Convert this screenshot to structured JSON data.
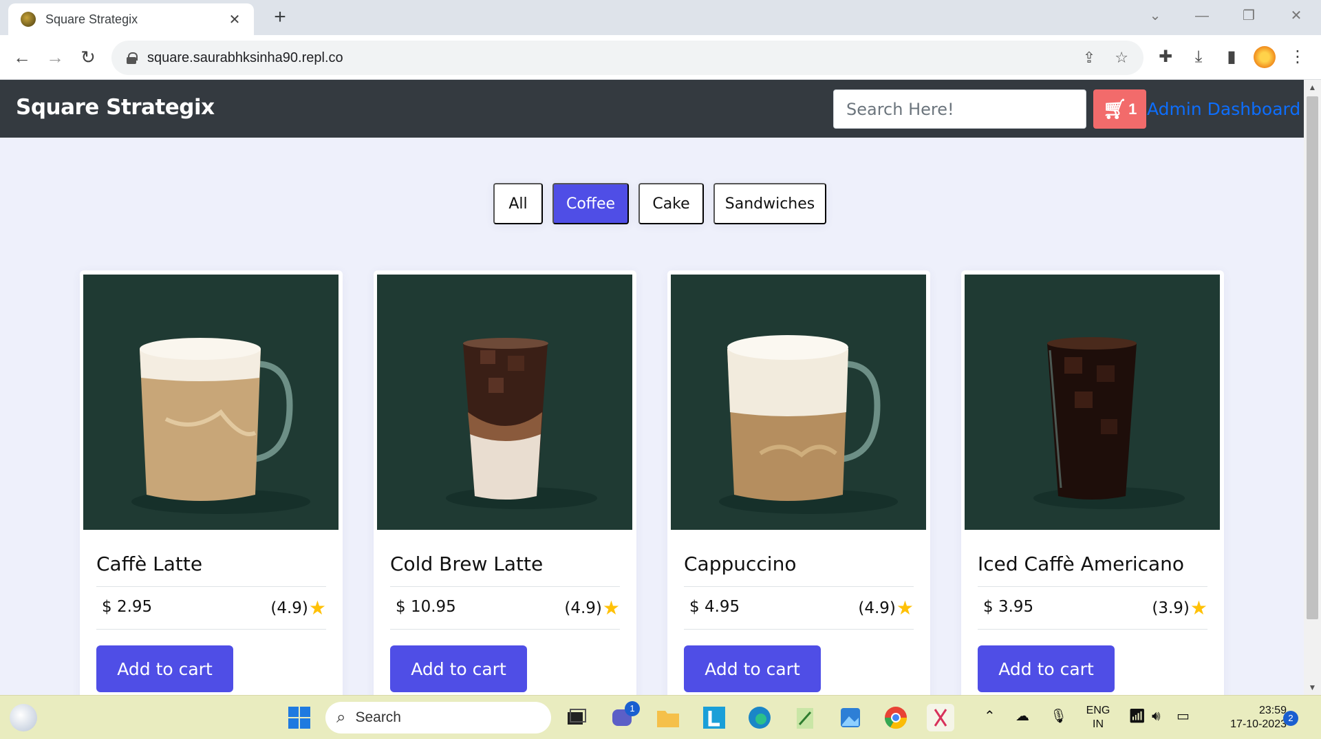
{
  "browser": {
    "tab_title": "Square Strategix",
    "new_tab_label": "+",
    "url": "square.saurabhksinha90.repl.co"
  },
  "header": {
    "brand": "Square Strategix",
    "search_placeholder": "Search Here!",
    "cart_count": "1",
    "admin_link": "Admin Dashboard"
  },
  "filters": [
    {
      "label": "All",
      "active": false
    },
    {
      "label": "Coffee",
      "active": true
    },
    {
      "label": "Cake",
      "active": false
    },
    {
      "label": "Sandwiches",
      "active": false
    }
  ],
  "products": [
    {
      "name": "Caffè Latte",
      "price": "$ 2.95",
      "rating": "(4.9)",
      "button": "Add to cart",
      "drink": "latte-mug"
    },
    {
      "name": "Cold Brew Latte",
      "price": "$ 10.95",
      "rating": "(4.9)",
      "button": "Add to cart",
      "drink": "cold-brew-glass"
    },
    {
      "name": "Cappuccino",
      "price": "$ 4.95",
      "rating": "(4.9)",
      "button": "Add to cart",
      "drink": "cappuccino-mug"
    },
    {
      "name": "Iced Caffè Americano",
      "price": "$ 3.95",
      "rating": "(3.9)",
      "button": "Add to cart",
      "drink": "iced-americano-glass"
    }
  ],
  "taskbar": {
    "search_label": "Search",
    "language_line1": "ENG",
    "language_line2": "IN",
    "time": "23:59",
    "date": "17-10-2023",
    "notification_count": "2",
    "teams_badge": "1"
  },
  "colors": {
    "accent": "#4f4ee6",
    "header_bg": "#343a40",
    "cart_button": "#f26b6b",
    "link": "#0d6efd",
    "product_image_bg": "#1f3a33",
    "star": "#ffc107"
  }
}
